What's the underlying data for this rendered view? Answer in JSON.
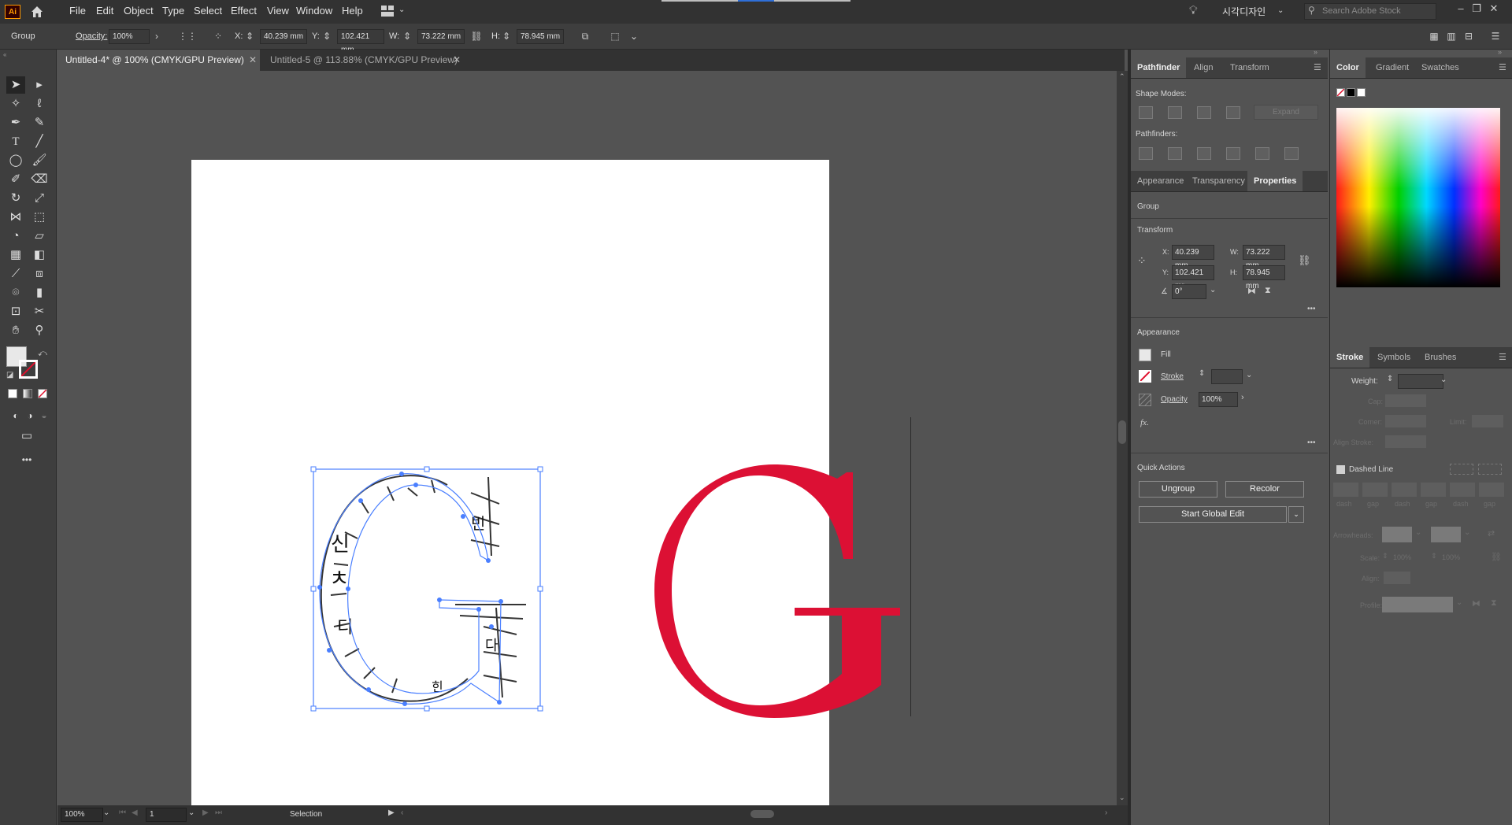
{
  "app": {
    "logo": "Ai",
    "menu": [
      "File",
      "Edit",
      "Object",
      "Type",
      "Select",
      "Effect",
      "View",
      "Window",
      "Help"
    ],
    "workspace": "시각디자인",
    "search_placeholder": "Search Adobe Stock"
  },
  "control_bar": {
    "selection_type": "Group",
    "opacity_label": "Opacity:",
    "opacity_value": "100%",
    "x_label": "X:",
    "x_value": "40.239 mm",
    "y_label": "Y:",
    "y_value": "102.421 mm",
    "w_label": "W:",
    "w_value": "73.222 mm",
    "h_label": "H:",
    "h_value": "78.945 mm"
  },
  "tabs": [
    {
      "label": "Untitled-4* @ 100% (CMYK/GPU Preview)",
      "active": true
    },
    {
      "label": "Untitled-5 @ 113.88% (CMYK/GPU Preview)",
      "active": false
    }
  ],
  "canvas": {
    "glyph_outline": "G",
    "glyph_filled": "G",
    "glyph_color": "#dc1034",
    "selection_color": "#4a7fff"
  },
  "status": {
    "zoom": "100%",
    "artboard": "1",
    "tool": "Selection"
  },
  "pathfinder_panel": {
    "tabs": [
      "Pathfinder",
      "Align",
      "Transform"
    ],
    "shape_modes_label": "Shape Modes:",
    "expand_label": "Expand",
    "pathfinders_label": "Pathfinders:"
  },
  "properties_panel": {
    "tabs": [
      "Appearance",
      "Transparency",
      "Properties"
    ],
    "selection": "Group",
    "transform_label": "Transform",
    "x_label": "X:",
    "x_value": "40.239 mm",
    "y_label": "Y:",
    "y_value": "102.421 mr",
    "w_label": "W:",
    "w_value": "73.222 mm",
    "h_label": "H:",
    "h_value": "78.945 mm",
    "rotate_value": "0°",
    "appearance_label": "Appearance",
    "fill_label": "Fill",
    "stroke_label": "Stroke",
    "opacity_label": "Opacity",
    "opacity_value": "100%",
    "fx_label": "fx.",
    "quick_actions_label": "Quick Actions",
    "ungroup_label": "Ungroup",
    "recolor_label": "Recolor",
    "global_edit_label": "Start Global Edit",
    "more": "•••"
  },
  "color_panel": {
    "tabs": [
      "Color",
      "Gradient",
      "Swatches"
    ]
  },
  "stroke_panel": {
    "tabs": [
      "Stroke",
      "Symbols",
      "Brushes"
    ],
    "weight_label": "Weight:",
    "cap_label": "Cap:",
    "corner_label": "Corner:",
    "limit_label": "Limit:",
    "align_label": "Align Stroke:",
    "dashed_label": "Dashed Line",
    "dash_labels": [
      "dash",
      "gap",
      "dash",
      "gap",
      "dash",
      "gap"
    ],
    "arrowheads_label": "Arrowheads:",
    "scale_label": "Scale:",
    "scale_value_1": "100%",
    "scale_value_2": "100%",
    "align_label2": "Align:",
    "profile_label": "Profile:"
  }
}
